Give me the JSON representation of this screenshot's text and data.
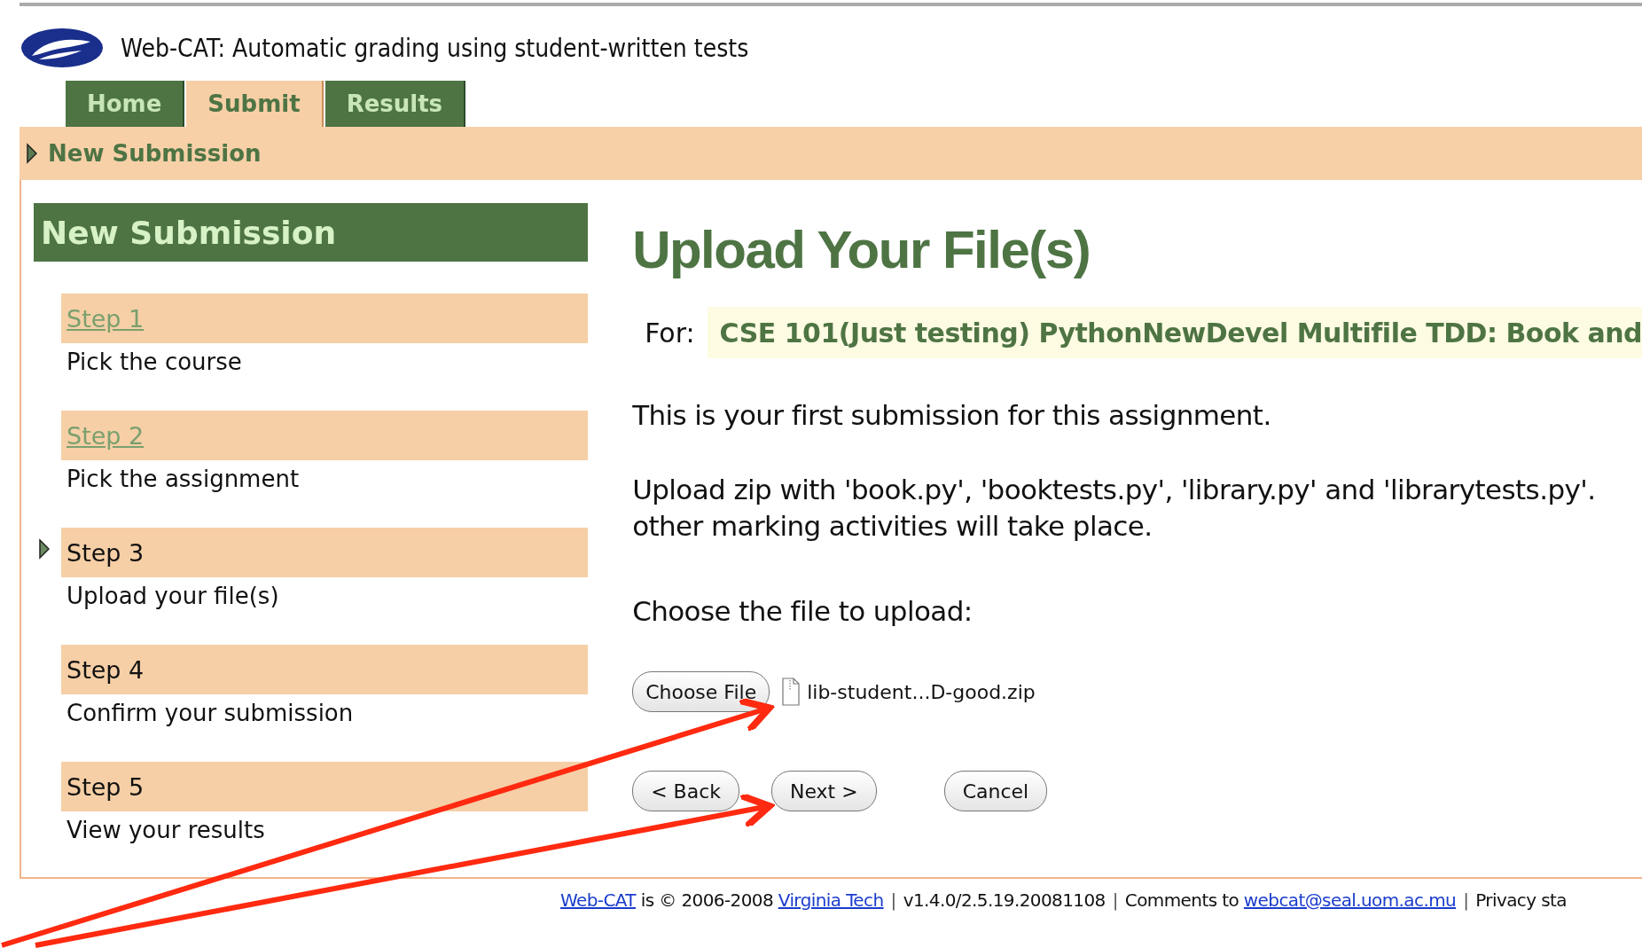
{
  "header": {
    "title": "Web-CAT: Automatic grading using student-written tests"
  },
  "tabs": [
    {
      "label": "Home",
      "selected": false
    },
    {
      "label": "Submit",
      "selected": true
    },
    {
      "label": "Results",
      "selected": false
    }
  ],
  "breadcrumb": {
    "label": "New Submission"
  },
  "sidebar": {
    "title": "New Submission",
    "steps": [
      {
        "label": "Step 1",
        "description": "Pick the course",
        "link": true,
        "current": false
      },
      {
        "label": "Step 2",
        "description": "Pick the assignment",
        "link": true,
        "current": false
      },
      {
        "label": "Step 3",
        "description": "Upload your file(s)",
        "link": false,
        "current": true
      },
      {
        "label": "Step 4",
        "description": "Confirm your submission",
        "link": false,
        "current": false
      },
      {
        "label": "Step 5",
        "description": "View your results",
        "link": false,
        "current": false
      }
    ]
  },
  "main": {
    "title": "Upload Your File(s)",
    "for_label": "For:",
    "assignment": "CSE 101(Just testing) PythonNewDevel Multifile TDD: Book and",
    "messages": [
      {
        "lines": [
          "This is your first submission for this assignment."
        ]
      },
      {
        "lines": [
          "Upload zip with 'book.py', 'booktests.py', 'library.py' and 'librarytests.py'.",
          "other marking activities will take place."
        ]
      }
    ],
    "upload_prompt": "Choose the file to upload:",
    "choose_file_button": "Choose File",
    "file_name": "lib-student...D-good.zip",
    "buttons": [
      "< Back",
      "Next >",
      "Cancel"
    ]
  },
  "footer": {
    "segments": [
      {
        "kind": "link",
        "text": "Web-CAT"
      },
      {
        "kind": "text",
        "text": " is © 2006-2008 "
      },
      {
        "kind": "link",
        "text": "Virginia Tech"
      },
      {
        "kind": "separator",
        "text": "|"
      },
      {
        "kind": "text",
        "text": "v1.4.0/2.5.19.20081108"
      },
      {
        "kind": "separator",
        "text": "|"
      },
      {
        "kind": "text",
        "text": "Comments to "
      },
      {
        "kind": "link",
        "text": "webcat@seal.uom.ac.mu"
      },
      {
        "kind": "separator",
        "text": "|"
      },
      {
        "kind": "text",
        "text": "Privacy sta"
      }
    ]
  }
}
